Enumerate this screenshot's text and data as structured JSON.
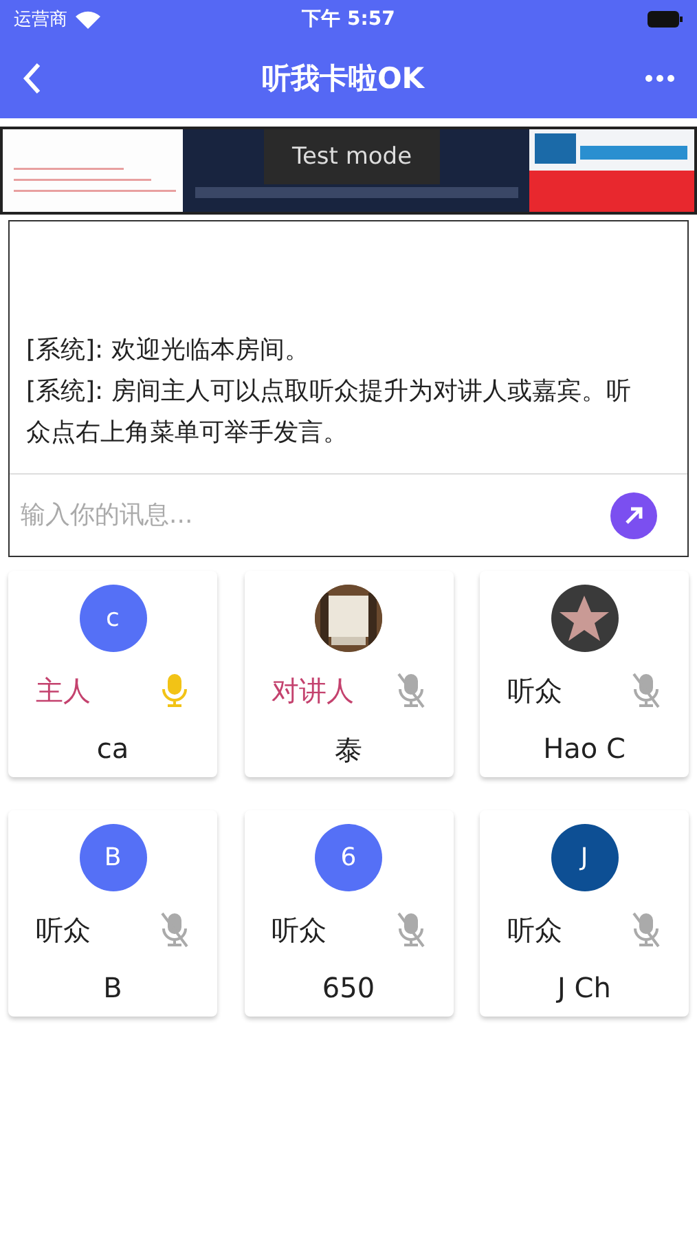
{
  "status_bar": {
    "carrier": "运营商",
    "time": "下午 5:57"
  },
  "header": {
    "title": "听我卡啦OK"
  },
  "ad": {
    "kind": "picture",
    "toast": "Test mode"
  },
  "chat": {
    "messages": [
      {
        "sender": "[系统]:",
        "text": "欢迎光临本房间。"
      },
      {
        "sender": "[系统]:",
        "text": "房间主人可以点取听众提升为对讲人或嘉宾。听众点右上角菜单可举手发言。"
      }
    ],
    "input": {
      "placeholder": "输入你的讯息..."
    }
  },
  "participants": [
    {
      "avatar": {
        "kind": "letter",
        "letter": "c",
        "color": "#5570f6"
      },
      "role": "主人",
      "color": "#c4426e",
      "muted": false,
      "name": "ca"
    },
    {
      "role": "对讲人",
      "color": "#c4426e",
      "muted": true,
      "name": "泰"
    },
    {
      "avatar": {
        "kind": "star"
      },
      "role": "听众",
      "color": "#222222",
      "muted": true,
      "name": "Hao C"
    },
    {
      "avatar": {
        "kind": "letter",
        "letter": "B",
        "color": "#5570f6"
      },
      "role": "听众",
      "color": "#222222",
      "muted": true,
      "name": "B"
    },
    {
      "avatar": {
        "kind": "letter",
        "letter": "6",
        "color": "#5570f6"
      },
      "role": "听众",
      "color": "#222222",
      "muted": true,
      "name": "650"
    },
    {
      "avatar": {
        "kind": "letter",
        "letter": "J",
        "color": "#0d4f94"
      },
      "role": "听众",
      "color": "#222222",
      "muted": true,
      "name": "J Ch"
    }
  ]
}
